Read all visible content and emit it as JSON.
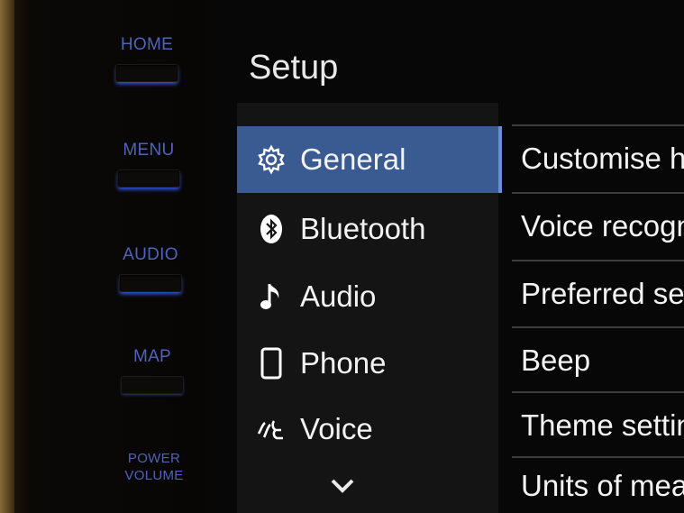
{
  "hardware": {
    "home": "HOME",
    "menu": "MENU",
    "audio": "AUDIO",
    "map": "MAP",
    "power_volume": [
      "POWER",
      "VOLUME"
    ]
  },
  "screen": {
    "title": "Setup",
    "menu": [
      {
        "label": "General",
        "icon": "gear-icon",
        "selected": true
      },
      {
        "label": "Bluetooth",
        "icon": "bluetooth-icon"
      },
      {
        "label": "Audio",
        "icon": "music-note-icon"
      },
      {
        "label": "Phone",
        "icon": "phone-icon"
      },
      {
        "label": "Voice",
        "icon": "voice-icon"
      }
    ],
    "more_icon": "chevron-down-icon",
    "settings": [
      "Customise ho",
      "Voice recognit",
      "Preferred servi",
      "Beep",
      "Theme setting",
      "Units of measu"
    ]
  },
  "colors": {
    "selected_bg": "#3a5a92",
    "hardware_label": "#4f63b8",
    "hardware_glow": "#3b5cff"
  }
}
